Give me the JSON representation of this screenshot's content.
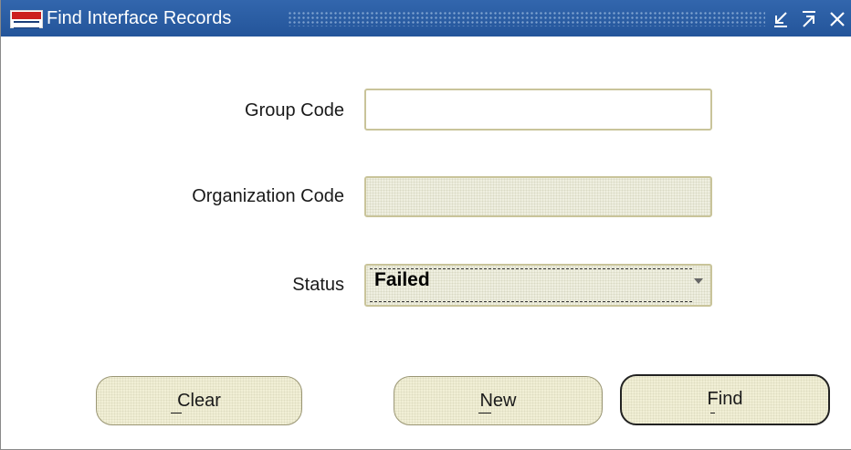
{
  "window": {
    "title": "Find Interface Records",
    "controls": {
      "minimize_icon": "minimize-icon",
      "maximize_icon": "maximize-icon",
      "close_icon": "close-icon"
    }
  },
  "form": {
    "group_code": {
      "label": "Group Code",
      "value": ""
    },
    "organization_code": {
      "label": "Organization Code",
      "value": ""
    },
    "status": {
      "label": "Status",
      "value": "Failed"
    }
  },
  "buttons": {
    "clear": "Clear",
    "new": "New",
    "find": "Find"
  },
  "colors": {
    "titlebar": "#2a5ca0",
    "field_border": "#c9c49a",
    "button_face": "#f1efd6"
  }
}
